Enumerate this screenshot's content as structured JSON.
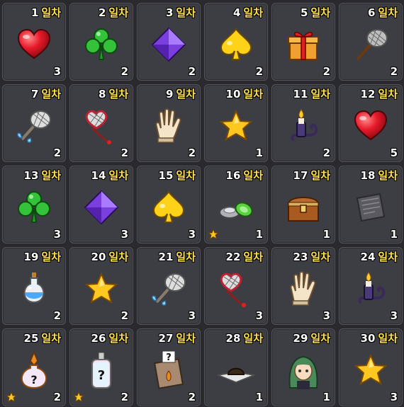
{
  "unit_label": "일차",
  "rewards": [
    {
      "day": "1",
      "qty": "3",
      "icon": "heart-icon",
      "starred": false
    },
    {
      "day": "2",
      "qty": "2",
      "icon": "clover-icon",
      "starred": false
    },
    {
      "day": "3",
      "qty": "2",
      "icon": "diamond-icon",
      "starred": false
    },
    {
      "day": "4",
      "qty": "2",
      "icon": "spade-icon",
      "starred": false
    },
    {
      "day": "5",
      "qty": "2",
      "icon": "gift-box-icon",
      "starred": false
    },
    {
      "day": "6",
      "qty": "2",
      "icon": "bug-net-icon",
      "starred": false
    },
    {
      "day": "7",
      "qty": "2",
      "icon": "winged-net-icon",
      "starred": false
    },
    {
      "day": "8",
      "qty": "2",
      "icon": "heart-net-icon",
      "starred": false
    },
    {
      "day": "9",
      "qty": "2",
      "icon": "glove-icon",
      "starred": false
    },
    {
      "day": "10",
      "qty": "1",
      "icon": "star-icon",
      "starred": false
    },
    {
      "day": "11",
      "qty": "2",
      "icon": "candle-icon",
      "starred": false
    },
    {
      "day": "12",
      "qty": "5",
      "icon": "heart-icon",
      "starred": false
    },
    {
      "day": "13",
      "qty": "3",
      "icon": "clover-icon",
      "starred": false
    },
    {
      "day": "14",
      "qty": "3",
      "icon": "diamond-icon",
      "starred": false
    },
    {
      "day": "15",
      "qty": "3",
      "icon": "spade-icon",
      "starred": false
    },
    {
      "day": "16",
      "qty": "1",
      "icon": "ring-disc-icon",
      "starred": true
    },
    {
      "day": "17",
      "qty": "1",
      "icon": "treasure-chest-icon",
      "starred": false
    },
    {
      "day": "18",
      "qty": "1",
      "icon": "scroll-icon",
      "starred": false
    },
    {
      "day": "19",
      "qty": "2",
      "icon": "potion-icon",
      "starred": false
    },
    {
      "day": "20",
      "qty": "2",
      "icon": "star-icon",
      "starred": false
    },
    {
      "day": "21",
      "qty": "3",
      "icon": "winged-net-icon",
      "starred": false
    },
    {
      "day": "22",
      "qty": "3",
      "icon": "heart-net-icon",
      "starred": false
    },
    {
      "day": "23",
      "qty": "3",
      "icon": "glove-icon",
      "starred": false
    },
    {
      "day": "24",
      "qty": "3",
      "icon": "candle-icon",
      "starred": false
    },
    {
      "day": "25",
      "qty": "2",
      "icon": "mystery-flask-icon",
      "starred": true
    },
    {
      "day": "26",
      "qty": "2",
      "icon": "mystery-bottle-icon",
      "starred": true
    },
    {
      "day": "27",
      "qty": "2",
      "icon": "mystery-bag-icon",
      "starred": false
    },
    {
      "day": "28",
      "qty": "1",
      "icon": "hat-icon",
      "starred": false
    },
    {
      "day": "29",
      "qty": "1",
      "icon": "character-icon",
      "starred": false
    },
    {
      "day": "30",
      "qty": "3",
      "icon": "star-icon",
      "starred": false
    }
  ]
}
